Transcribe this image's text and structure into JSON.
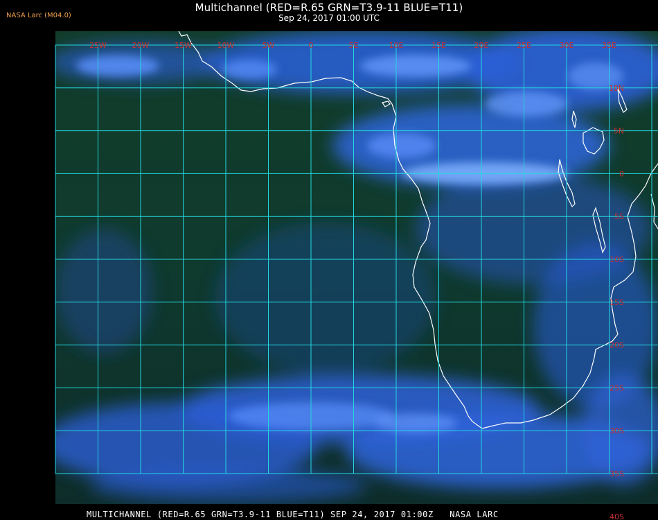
{
  "header": {
    "title": "Multichannel (RED=R.65 GRN=T3.9-11 BLUE=T11)",
    "subtitle": "Sep 24, 2017 01:00 UTC",
    "brand": "NASA Larc (M04.0)"
  },
  "footer": {
    "caption": "MULTICHANNEL (RED=R.65 GRN=T3.9-11 BLUE=T11) SEP 24, 2017 01:00Z   NASA LARC"
  },
  "map": {
    "region": "Southern Africa and South Atlantic",
    "lon_labels": [
      "25W",
      "20W",
      "15W",
      "10W",
      "5W",
      "0",
      "5E",
      "10E",
      "15E",
      "20E",
      "25E",
      "30E",
      "35E"
    ],
    "lat_labels": [
      "10N",
      "5N",
      "0",
      "5S",
      "10S",
      "15S",
      "20S",
      "25S",
      "30S",
      "35S",
      "40S"
    ],
    "colors": {
      "grid": "#22d8e0",
      "labels": "#c83030",
      "coastline": "#ffffff",
      "clear_sky": "#0e3a22",
      "cloud": "#2f62d8",
      "high_cloud": "#7fb2ff"
    }
  }
}
